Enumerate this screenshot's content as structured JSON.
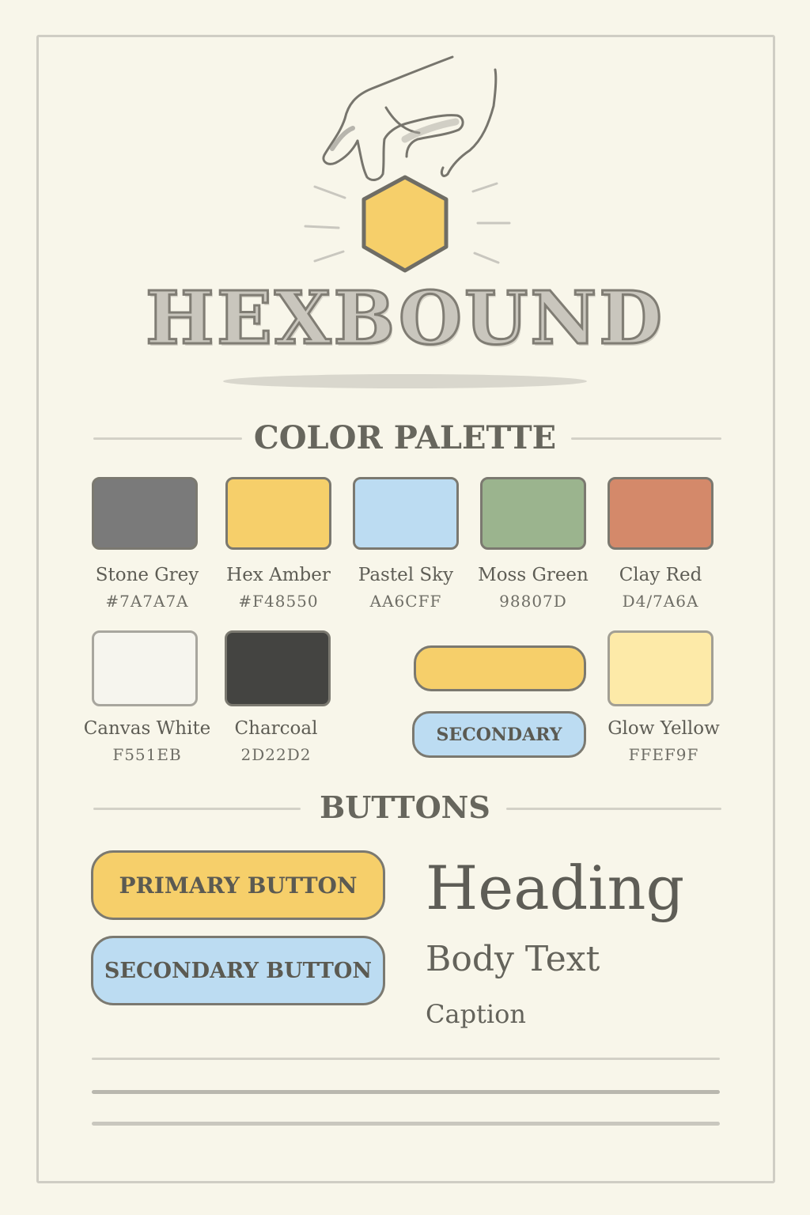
{
  "brand": {
    "name": "HEXBOUND"
  },
  "logo": {
    "hand_icon": "hand-icon",
    "hexagon_icon": "hexagon-icon",
    "hex_color": "#f6cf6a"
  },
  "palette_section": {
    "title": "COLOR PALETTE",
    "swatches": [
      {
        "name": "Stone Grey",
        "hex": "#7A7A7A",
        "color": "#7a7a7a"
      },
      {
        "name": "Hex Amber",
        "hex": "#F48550",
        "color": "#f6cf6a"
      },
      {
        "name": "Pastel Sky",
        "hex": "AA6CFF",
        "color": "#bcdcf2"
      },
      {
        "name": "Moss Green",
        "hex": "98807D",
        "color": "#9bb48e"
      },
      {
        "name": "Clay Red",
        "hex": "D4/7A6A",
        "color": "#d4896a"
      },
      {
        "name": "Canvas White",
        "hex": "F551EB",
        "color": "#f6f5ee"
      },
      {
        "name": "Charcoal",
        "hex": "2D22D2",
        "color": "#444441"
      },
      {
        "name": "Glow Yellow",
        "hex": "FFEF9F",
        "color": "#fdeaa8"
      }
    ],
    "mini_secondary_label": "SECONDARY"
  },
  "buttons_section": {
    "title": "BUTTONS",
    "primary_label": "PRIMARY BUTTON",
    "secondary_label": "SECONDARY BUTTON"
  },
  "typography": {
    "heading": "Heading",
    "body": "Body Text",
    "caption": "Caption"
  },
  "colors": {
    "amber": "#f6cf6a",
    "sky": "#bcdcf2",
    "outline": "#7b7970",
    "background": "#f8f6ea"
  }
}
